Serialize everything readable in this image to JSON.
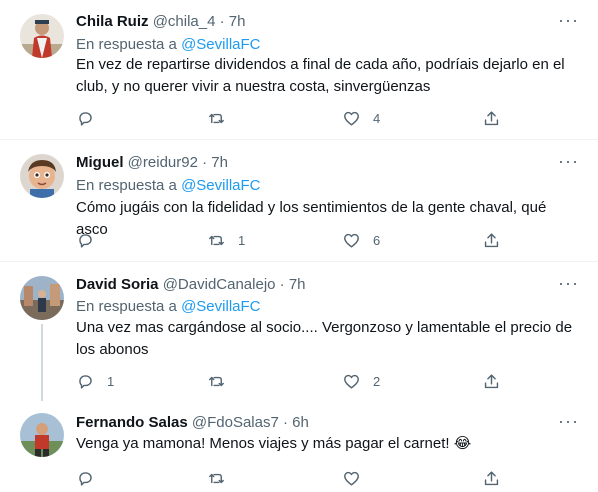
{
  "tweets": [
    {
      "name": "Chila Ruiz",
      "handle": "@chila_4",
      "dot": "·",
      "time": "7h",
      "reply_prefix": "En respuesta a ",
      "reply_to": "@SevillaFC",
      "text_line1": "En vez de repartirse dividendos a final de cada año, podríais dejarlo en el",
      "text_line2": "club, y no querer vivir a nuestra costa, sinvergüenzas",
      "replies": "",
      "retweets": "",
      "likes": "4",
      "more": "···"
    },
    {
      "name": "Miguel",
      "handle": "@reidur92",
      "dot": "·",
      "time": "7h",
      "reply_prefix": "En respuesta a ",
      "reply_to": "@SevillaFC",
      "text_line1": "Cómo jugáis con la fidelidad y los sentimientos de la gente chaval, qué asco",
      "replies": "",
      "retweets": "1",
      "likes": "6",
      "more": "···"
    },
    {
      "name": "David Soria",
      "handle": "@DavidCanalejo",
      "dot": "·",
      "time": "7h",
      "reply_prefix": "En respuesta a ",
      "reply_to": "@SevillaFC",
      "text_line1": "Una vez mas cargándose al socio.... Vergonzoso y lamentable el precio de",
      "text_line2": "los abonos",
      "replies": "1",
      "retweets": "",
      "likes": "2",
      "more": "···"
    },
    {
      "name": "Fernando Salas",
      "handle": "@FdoSalas7",
      "dot": "·",
      "time": "6h",
      "text_line1": "Venga ya mamona! Menos viajes y más pagar el carnet! 😂",
      "replies": "",
      "retweets": "",
      "likes": "",
      "more": "···"
    }
  ],
  "icons": {
    "reply": "reply-icon",
    "retweet": "retweet-icon",
    "like": "heart-icon",
    "share": "share-icon",
    "more": "more-icon"
  },
  "colors": {
    "link": "#1d9bf0",
    "secondary_text": "#536471",
    "divider": "#eff3f4"
  }
}
